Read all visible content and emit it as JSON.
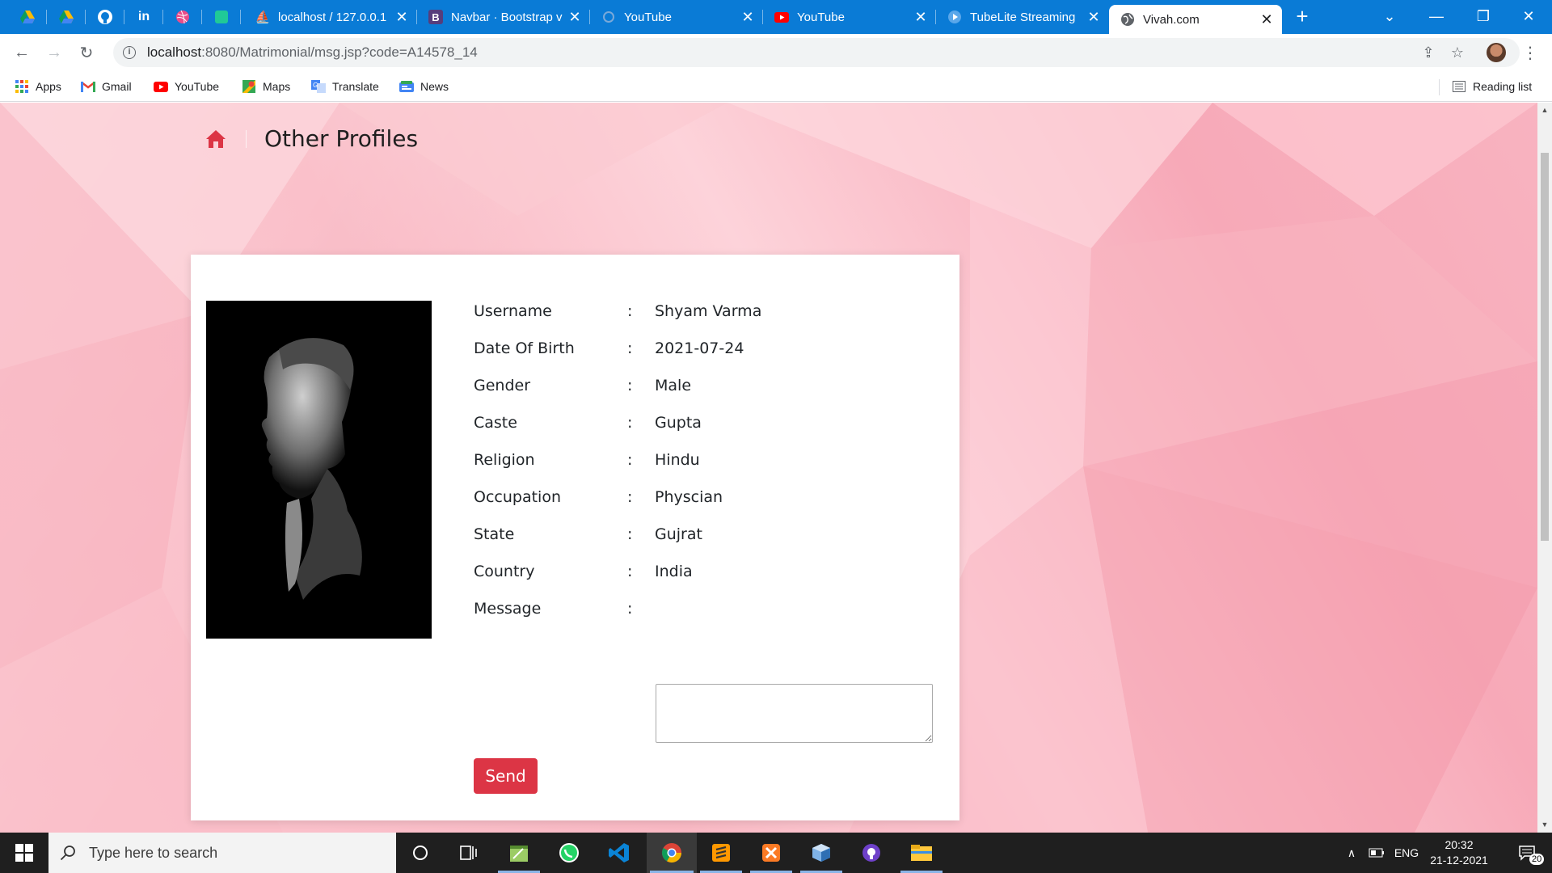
{
  "browser": {
    "pinned_tabs": [
      "google-drive-icon",
      "google-drive-icon",
      "github-icon",
      "linkedin-icon",
      "dribbble-icon",
      "green-app-icon"
    ],
    "tabs": [
      {
        "title": "localhost / 127.0.0.1",
        "icon": "phpmyadmin-icon"
      },
      {
        "title": "Navbar · Bootstrap v",
        "icon": "bootstrap-icon"
      },
      {
        "title": "YouTube",
        "icon": "loading-icon"
      },
      {
        "title": "YouTube",
        "icon": "youtube-icon"
      },
      {
        "title": "TubeLite Streaming",
        "icon": "tubelite-icon"
      },
      {
        "title": "Vivah.com",
        "icon": "globe-icon",
        "active": true
      }
    ],
    "url": {
      "host": "localhost",
      "path": ":8080/Matrimonial/msg.jsp?code=A14578_14"
    },
    "bookmarks": [
      {
        "label": "Apps",
        "icon": "apps-grid-icon"
      },
      {
        "label": "Gmail",
        "icon": "gmail-icon"
      },
      {
        "label": "YouTube",
        "icon": "youtube-icon"
      },
      {
        "label": "Maps",
        "icon": "maps-icon"
      },
      {
        "label": "Translate",
        "icon": "translate-icon"
      },
      {
        "label": "News",
        "icon": "news-icon"
      }
    ],
    "reading_list": "Reading list"
  },
  "page": {
    "breadcrumb_title": "Other Profiles",
    "accent_color": "#dc3545",
    "profile": {
      "fields": [
        {
          "label": "Username",
          "value": "Shyam Varma"
        },
        {
          "label": "Date Of Birth",
          "value": "2021-07-24"
        },
        {
          "label": "Gender",
          "value": "Male"
        },
        {
          "label": "Caste",
          "value": "Gupta"
        },
        {
          "label": "Religion",
          "value": "Hindu"
        },
        {
          "label": "Occupation",
          "value": "Physcian"
        },
        {
          "label": "State",
          "value": "Gujrat"
        },
        {
          "label": "Country",
          "value": "India"
        }
      ],
      "message_label": "Message",
      "separator": ":",
      "message_value": "",
      "send_label": "Send"
    }
  },
  "taskbar": {
    "search_placeholder": "Type here to search",
    "apps": [
      "cortana-icon",
      "task-view-icon",
      "notepad-icon",
      "whatsapp-icon",
      "vscode-icon",
      "chrome-icon",
      "sublime-icon",
      "xampp-icon",
      "virtualbox-icon",
      "github-desktop-icon",
      "file-explorer-icon"
    ],
    "language": "ENG",
    "time": "20:32",
    "date": "21-12-2021",
    "notification_count": "20"
  }
}
